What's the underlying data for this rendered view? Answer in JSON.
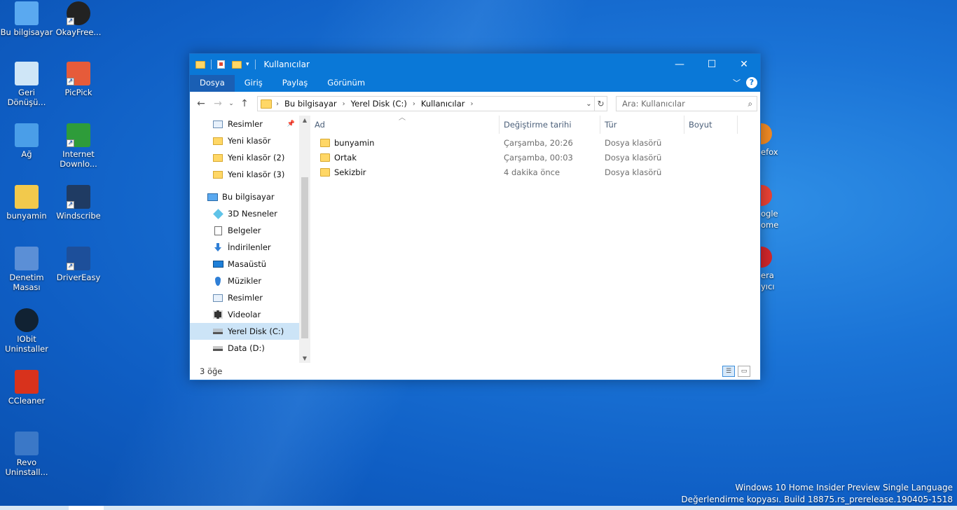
{
  "desktop": {
    "icons": [
      {
        "label": "Bu bilgisayar",
        "icon": "computer-icon",
        "shortcut": false
      },
      {
        "label": "OkayFree...",
        "icon": "okayfreedom-icon",
        "shortcut": true
      },
      {
        "label": "Geri Dönüşü...",
        "icon": "recycle-bin-icon",
        "shortcut": false
      },
      {
        "label": "PicPick",
        "icon": "picpick-icon",
        "shortcut": true
      },
      {
        "label": "Ağ",
        "icon": "network-icon",
        "shortcut": false
      },
      {
        "label": "Internet Downlo...",
        "icon": "idm-icon",
        "shortcut": true
      },
      {
        "label": "bunyamin",
        "icon": "user-folder-icon",
        "shortcut": false
      },
      {
        "label": "Windscribe",
        "icon": "windscribe-icon",
        "shortcut": true
      },
      {
        "label": "Denetim Masası",
        "icon": "control-panel-icon",
        "shortcut": false
      },
      {
        "label": "DriverEasy",
        "icon": "drivereasy-icon",
        "shortcut": true
      },
      {
        "label": "IObit Uninstaller",
        "icon": "iobit-icon",
        "shortcut": false
      },
      {
        "label": "CCleaner",
        "icon": "ccleaner-icon",
        "shortcut": false
      },
      {
        "label": "Revo Uninstall...",
        "icon": "revo-icon",
        "shortcut": false
      }
    ],
    "partial_labels": [
      "efox",
      "ogle",
      "ome",
      "era",
      "yıcı"
    ],
    "watermark_line1": "Windows 10 Home Insider Preview Single Language",
    "watermark_line2": "Değerlendirme kopyası. Build 18875.rs_prerelease.190405-1518"
  },
  "window": {
    "title": "Kullanıcılar",
    "controls": {
      "minimize": "—",
      "maximize": "☐",
      "close": "✕"
    },
    "ribbon_tabs": [
      {
        "label": "Dosya",
        "active": true
      },
      {
        "label": "Giriş",
        "active": false
      },
      {
        "label": "Paylaş",
        "active": false
      },
      {
        "label": "Görünüm",
        "active": false
      }
    ],
    "help": "?",
    "address": {
      "crumbs": [
        "Bu bilgisayar",
        "Yerel Disk (C:)",
        "Kullanıcılar"
      ]
    },
    "search_placeholder": "Ara: Kullanıcılar",
    "nav_pane": {
      "quick_access": [
        {
          "label": "Resimler",
          "icon": "pictures-icon",
          "pinned": true
        },
        {
          "label": "Yeni klasör",
          "icon": "folder-icon"
        },
        {
          "label": "Yeni klasör (2)",
          "icon": "folder-icon"
        },
        {
          "label": "Yeni klasör (3)",
          "icon": "folder-icon"
        }
      ],
      "this_pc_label": "Bu bilgisayar",
      "this_pc_items": [
        {
          "label": "3D Nesneler",
          "icon": "3d-objects-icon"
        },
        {
          "label": "Belgeler",
          "icon": "documents-icon"
        },
        {
          "label": "İndirilenler",
          "icon": "downloads-icon"
        },
        {
          "label": "Masaüstü",
          "icon": "desktop-icon"
        },
        {
          "label": "Müzikler",
          "icon": "music-icon"
        },
        {
          "label": "Resimler",
          "icon": "pictures-icon"
        },
        {
          "label": "Videolar",
          "icon": "videos-icon"
        },
        {
          "label": "Yerel Disk (C:)",
          "icon": "local-disk-icon",
          "selected": true
        },
        {
          "label": "Data (D:)",
          "icon": "drive-icon"
        }
      ]
    },
    "columns": [
      "Ad",
      "Değiştirme tarihi",
      "Tür",
      "Boyut"
    ],
    "files": [
      {
        "name": "bunyamin",
        "modified": "Çarşamba, 20:26",
        "type": "Dosya klasörü",
        "size": ""
      },
      {
        "name": "Ortak",
        "modified": "Çarşamba, 00:03",
        "type": "Dosya klasörü",
        "size": ""
      },
      {
        "name": "Sekizbir",
        "modified": "4 dakika önce",
        "type": "Dosya klasörü",
        "size": ""
      }
    ],
    "status": "3 öğe"
  }
}
